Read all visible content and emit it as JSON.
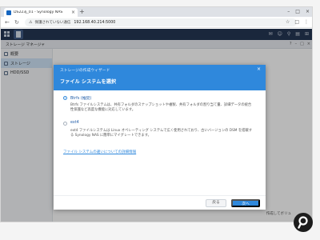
{
  "browser": {
    "tab_title": "DS223j_01 - Synology NAS",
    "tab_close_glyph": "×",
    "new_tab_glyph": "+",
    "window_controls": [
      "–",
      "□",
      "×"
    ],
    "nav_back": "←",
    "nav_reload": "↻",
    "security_icon_glyph": "⚠",
    "security_text": "保護されていない通信",
    "url": "192.168.40.214:5000",
    "addr_icons": [
      "☆",
      "□",
      "⋮"
    ]
  },
  "dsm": {
    "top_icons": [
      "✉",
      "☺",
      "⚲",
      "▤",
      "⊞"
    ]
  },
  "app": {
    "title": "ストレージ マネージャ",
    "titlebar_buttons": [
      "?",
      "–",
      "□",
      "×"
    ],
    "sidebar": [
      {
        "label": "概要",
        "icon": "overview-icon"
      },
      {
        "label": "ストレージ",
        "icon": "storage-icon",
        "active": true
      },
      {
        "label": "HDD/SSD",
        "icon": "hdd-icon"
      }
    ],
    "background_text": "作成してボリュ"
  },
  "wizard": {
    "kicker": "ストレージの作成ウィザード",
    "close_glyph": "×",
    "title": "ファイル システムを選択",
    "options": [
      {
        "label": "Btrfs (推奨)",
        "checked": true,
        "description": "Btrfs ファイルシステムは、共有フォルダのスナップショットや複製、共有フォルダの割り当て量、詳細データの統合性保護など高度な機能に対応しています。"
      },
      {
        "label": "ext4",
        "checked": false,
        "description": "ext4 ファイルシステムは Linux オペレーティング システムで広く使用されており、古いバージョンの DSM を搭載する Synology NAS に簡単にマイグレートできます。"
      }
    ],
    "info_link": "ファイル システムの違いについての詳細情報",
    "back_button": "戻る",
    "next_button": "次へ"
  },
  "colors": {
    "accent": "#2f88dc",
    "dsm_bar": "#243654"
  }
}
